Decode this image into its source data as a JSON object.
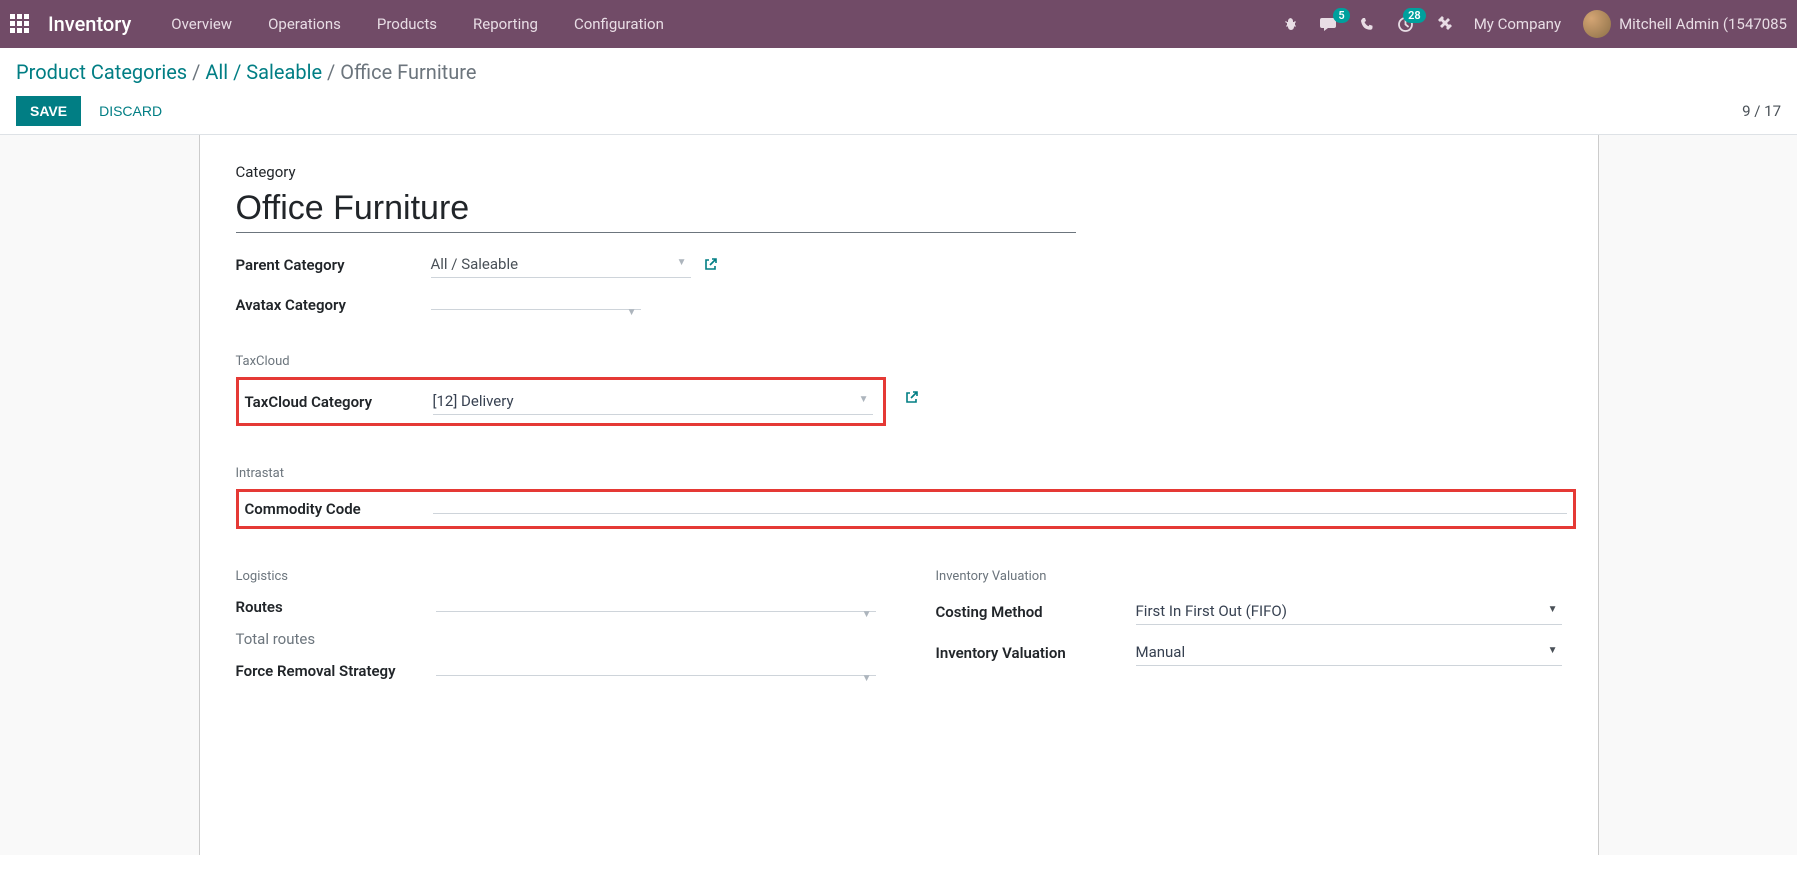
{
  "topbar": {
    "app_name": "Inventory",
    "nav": [
      "Overview",
      "Operations",
      "Products",
      "Reporting",
      "Configuration"
    ],
    "messages_badge": "5",
    "activities_badge": "28",
    "company": "My Company",
    "user": "Mitchell Admin (1547085"
  },
  "controlbar": {
    "root": "Product Categories",
    "sep1": " / ",
    "path": "All / Saleable",
    "sep2": " / ",
    "current": "Office Furniture",
    "save": "SAVE",
    "discard": "DISCARD",
    "pager": "9 / 17"
  },
  "form": {
    "category_label": "Category",
    "name": "Office Furniture",
    "parent_label": "Parent Category",
    "parent_value": "All / Saleable",
    "avatax_label": "Avatax Category",
    "avatax_value": "",
    "taxcloud_section": "TaxCloud",
    "taxcloud_label": "TaxCloud Category",
    "taxcloud_value": "[12] Delivery",
    "intrastat_section": "Intrastat",
    "commodity_label": "Commodity Code",
    "commodity_value": "",
    "logistics_section": "Logistics",
    "routes_label": "Routes",
    "routes_value": "",
    "total_routes_label": "Total routes",
    "force_removal_label": "Force Removal Strategy",
    "valuation_section": "Inventory Valuation",
    "costing_label": "Costing Method",
    "costing_value": "First In First Out (FIFO)",
    "invval_label": "Inventory Valuation",
    "invval_value": "Manual"
  }
}
